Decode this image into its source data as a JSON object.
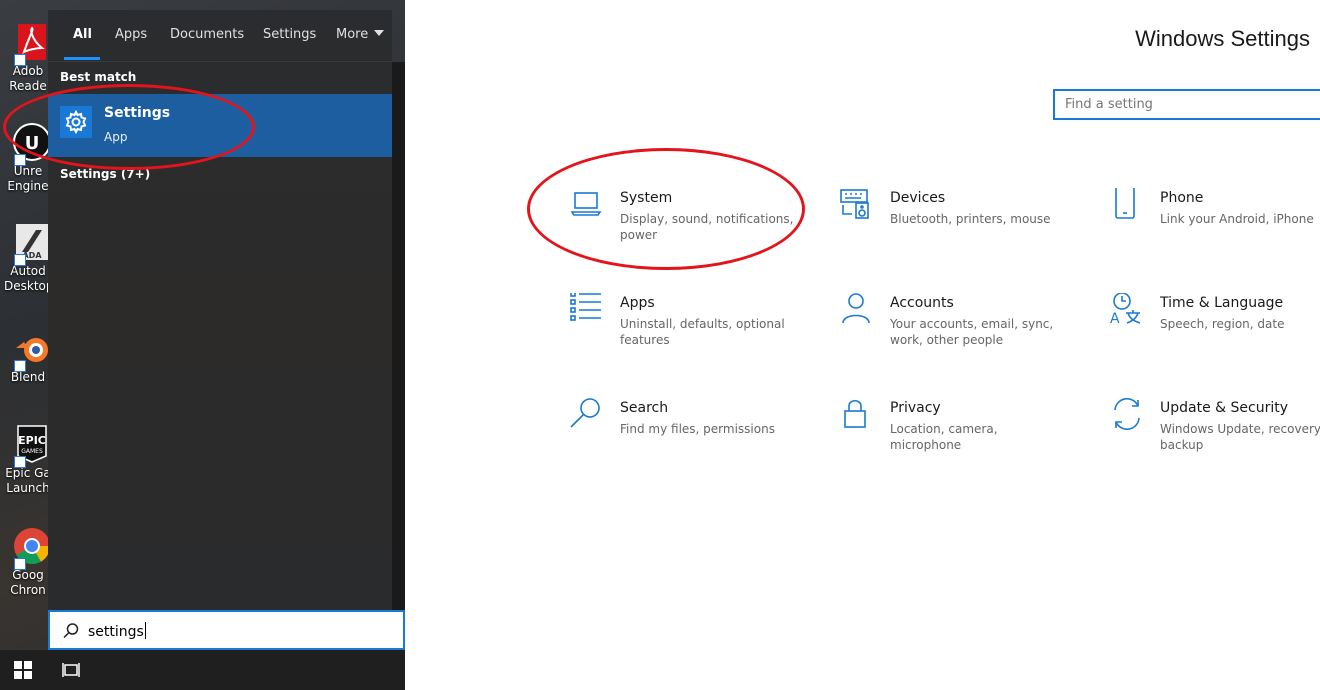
{
  "desktop": {
    "icons": [
      {
        "label1": "Adob",
        "label2": "Reade",
        "icon": "adobe-reader-icon"
      },
      {
        "label1": "Unre",
        "label2": "Engine",
        "icon": "unreal-engine-icon"
      },
      {
        "label1": "Autod",
        "label2": "Desktop",
        "icon": "autodesk-desktop-icon"
      },
      {
        "label1": "Blend",
        "label2": "",
        "icon": "blender-icon"
      },
      {
        "label1": "Epic Ga",
        "label2": "Launch",
        "icon": "epic-games-icon"
      },
      {
        "label1": "Goog",
        "label2": "Chron",
        "icon": "google-chrome-icon"
      }
    ]
  },
  "start_search": {
    "tabs": [
      {
        "label": "All",
        "active": true
      },
      {
        "label": "Apps"
      },
      {
        "label": "Documents"
      },
      {
        "label": "Settings"
      },
      {
        "label": "More"
      }
    ],
    "best_match_label": "Best match",
    "best_match": {
      "title": "Settings",
      "subtitle": "App",
      "icon": "gear-icon"
    },
    "group_label": "Settings (7+)",
    "query": "settings"
  },
  "settings_window": {
    "title": "Windows Settings",
    "find_placeholder": "Find a setting",
    "categories": [
      {
        "title": "System",
        "desc": "Display, sound, notifications, power",
        "icon": "laptop-icon"
      },
      {
        "title": "Devices",
        "desc": "Bluetooth, printers, mouse",
        "icon": "keyboard-speaker-icon"
      },
      {
        "title": "Phone",
        "desc": "Link your Android, iPhone",
        "icon": "phone-icon"
      },
      {
        "title": "Apps",
        "desc": "Uninstall, defaults, optional features",
        "icon": "apps-list-icon"
      },
      {
        "title": "Accounts",
        "desc": "Your accounts, email, sync, work, other people",
        "icon": "person-icon"
      },
      {
        "title": "Time & Language",
        "desc": "Speech, region, date",
        "icon": "time-language-icon"
      },
      {
        "title": "Search",
        "desc": "Find my files, permissions",
        "icon": "search-icon"
      },
      {
        "title": "Privacy",
        "desc": "Location, camera, microphone",
        "icon": "lock-icon"
      },
      {
        "title": "Update & Security",
        "desc": "Windows Update, recovery, backup",
        "icon": "sync-icon"
      }
    ]
  },
  "colors": {
    "accent": "#1a79d4",
    "annotation": "#e3141b",
    "selection": "#1c5ea0"
  }
}
